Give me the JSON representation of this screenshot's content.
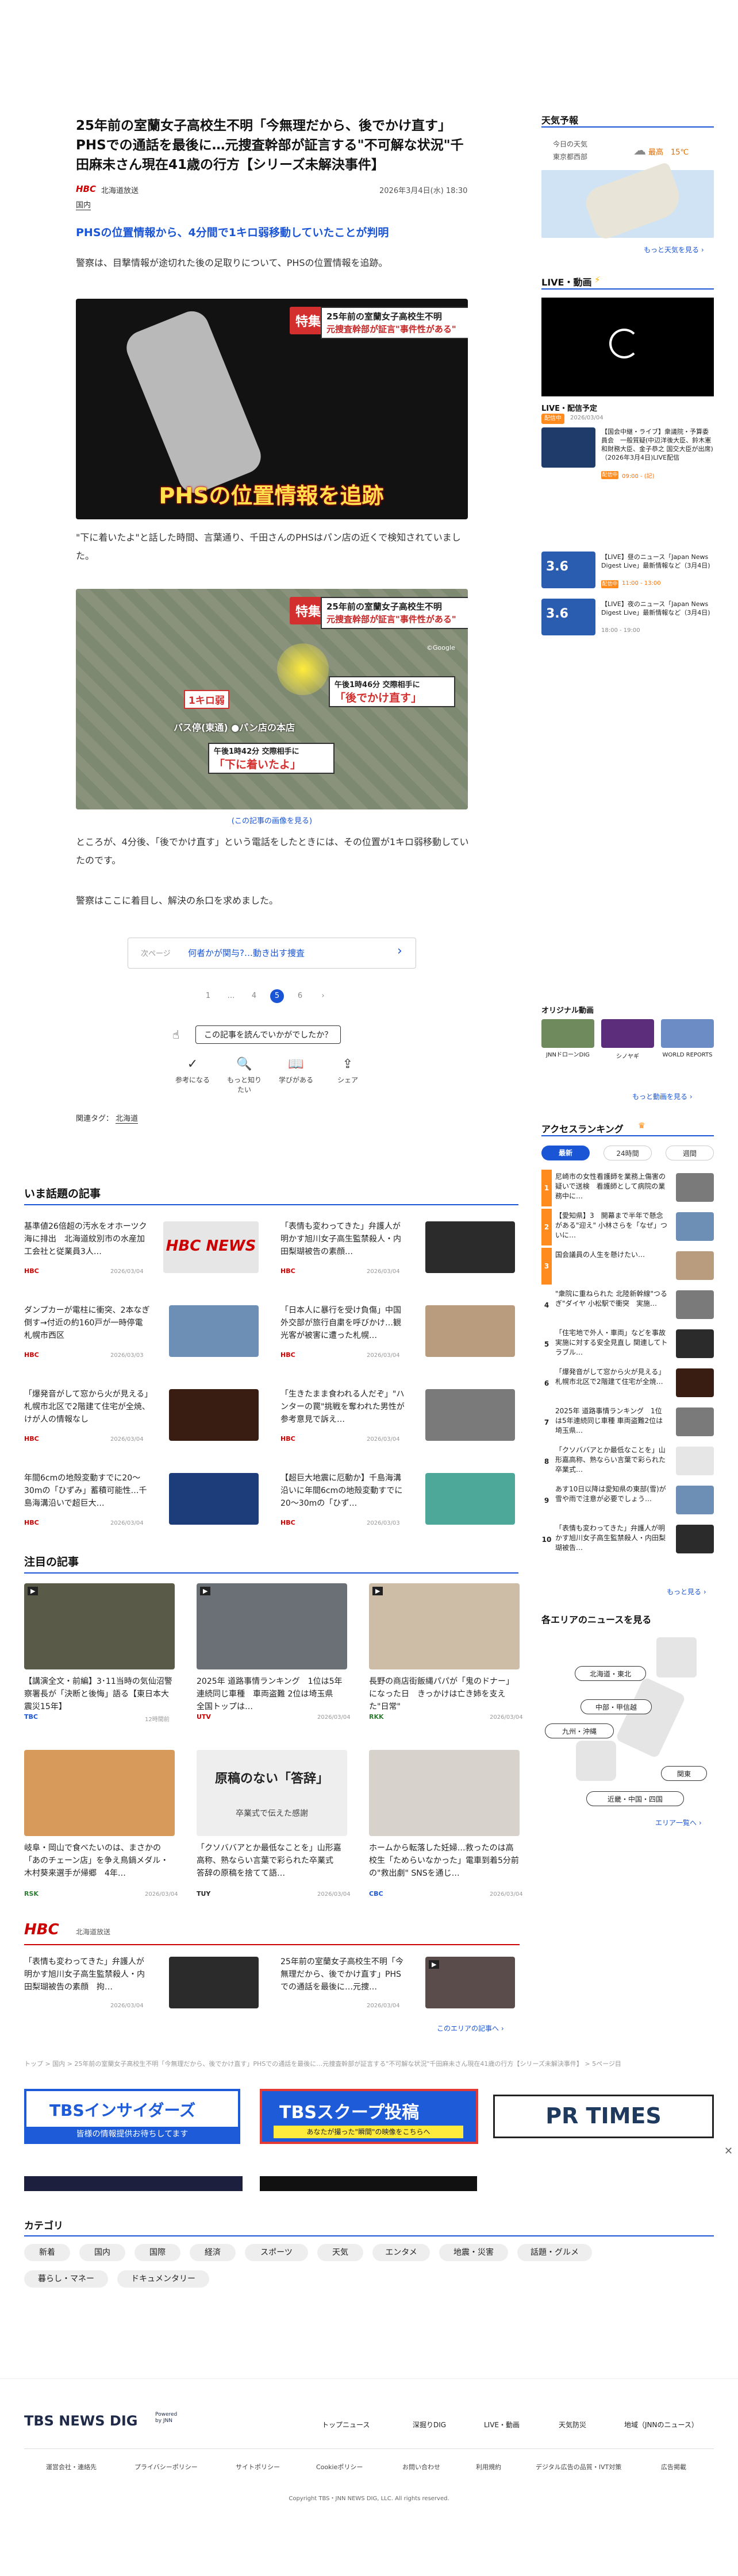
{
  "article": {
    "title": "25年前の室蘭女子高校生不明「今無理だから、後でかけ直す」PHSでの通話を最後に…元捜査幹部が証言する\"不可解な状況\"千田麻未さん現在41歳の行方【シリーズ未解決事件】",
    "logo": "HBC",
    "source": "北海道放送",
    "date": "2026年3月4日(水) 18:30",
    "category": "国内",
    "subhead": "PHSの位置情報から、4分間で1キロ弱移動していたことが判明",
    "p1": "警察は、目撃情報が途切れた後の足取りについて、PHSの位置情報を追跡。",
    "p2": "\"下に着いたよ\"と話した時間、言葉通り、千田さんのPHSはパン店の近くで検知されていました。",
    "caption2": "(この記事の画像を見る)",
    "p3": "ところが、4分後、「後でかけ直す」という電話をしたときには、その位置が1キロ弱移動していたのです。",
    "p4": "警察はここに着目し、解決の糸口を求めました。",
    "img1": {
      "tag": "特集",
      "line1": "25年前の室蘭女子高校生不明",
      "line2": "元捜査幹部が証言\"事件性がある\"",
      "bottom": "PHSの位置情報を追跡"
    },
    "img2": {
      "tag": "特集",
      "line1": "25年前の室蘭女子高校生不明",
      "line2": "元捜査幹部が証言\"事件性がある\"",
      "label_1km": "1キロ弱",
      "time_a": "午後1時46分 交際相手に",
      "quote_a": "「後でかけ直す」",
      "place": "バス停(東通)  ●パン店の本店",
      "time_b": "午後1時42分 交際相手に",
      "quote_b": "「下に着いたよ」",
      "credit": "©Google"
    },
    "next_page": {
      "label": "次ページ",
      "text": "何者かが関与?…動き出す捜査",
      "arrow": "›"
    },
    "pages": [
      "1",
      "…",
      "4",
      "5",
      "6",
      "›"
    ],
    "feedback": "この記事を読んでいかがでしたか？",
    "reactions": [
      {
        "icon": "✓",
        "label": "参考になる"
      },
      {
        "icon": "🔍",
        "label": "もっと知りたい"
      },
      {
        "icon": "📖",
        "label": "学びがある"
      },
      {
        "icon": "⇪",
        "label": "シェア"
      }
    ],
    "related_label": "関連タグ：",
    "related_tag": "北海道"
  },
  "trending": {
    "heading": "いま話題の記事",
    "items": [
      {
        "title": "基準値26倍超の汚水をオホーツク海に排出　北海道紋別市の水産加工会社と従業員3人…",
        "src": "HBC",
        "date": "2026/03/04",
        "thumb": "HBC NEWS"
      },
      {
        "title": "「表情も変わってきた」弁護人が明かす旭川女子高生監禁殺人・内田梨瑚被告の素顔…",
        "src": "HBC",
        "date": "2026/03/04",
        "thumb": ""
      },
      {
        "title": "ダンプカーが電柱に衝突、2本なぎ倒す→付近の約160戸が一時停電　札幌市西区",
        "src": "HBC",
        "date": "2026/03/03",
        "thumb": ""
      },
      {
        "title": "「日本人に暴行を受け負傷」中国外交部が旅行自粛を呼びかけ…観光客が被害に遭った札幌…",
        "src": "HBC",
        "date": "2026/03/04",
        "thumb": ""
      },
      {
        "title": "「爆発音がして窓から火が見える」札幌市北区で2階建て住宅が全焼、けが人の情報なし",
        "src": "HBC",
        "date": "2026/03/04",
        "thumb": ""
      },
      {
        "title": "「生きたまま食われる人だぞ」\"ハンターの罠\"挑戦を奪われた男性が参考意見で訴え…",
        "src": "HBC",
        "date": "2026/03/04",
        "thumb": ""
      },
      {
        "title": "年間6cmの地殻変動すでに20〜30mの「ひずみ」蓄積可能性…千島海溝沿いで超巨大…",
        "src": "HBC",
        "date": "2026/03/04",
        "thumb": ""
      },
      {
        "title": "【超巨大地震に厄動か】千島海溝沿いに年間6cmの地殻変動すでに20〜30mの「ひず…",
        "src": "HBC",
        "date": "2026/03/03",
        "thumb": ""
      }
    ]
  },
  "featured": {
    "heading": "注目の記事",
    "items": [
      {
        "title": "【講演全文・前編】3･11当時の気仙沼警察署長が「決断と後悔」語る【東日本大震災15年】",
        "src": "TBC",
        "date": "12時間前"
      },
      {
        "title": "2025年 道路事情ランキング　1位は5年連続同じ車種　車両盗難 2位は埼玉県　全国トップは…",
        "src": "UTV",
        "date": "2026/03/04"
      },
      {
        "title": "長野の商店街飯縄パパが「鬼のドナー」になった日　きっかけは亡き姉を支えた\"日常\"",
        "src": "RKK",
        "date": "2026/03/04"
      },
      {
        "title": "岐阜・岡山で食べたいのは、まさかの「あのチェーン店」を争え鳥鍋メダル・木村葵来選手が帰郷　4年…",
        "src": "RSK",
        "date": "2026/03/04"
      },
      {
        "title": "「クソババアとか最低なことを」山形嘉高称、熟ならい言葉で彩られた卒業式　答辞の原稿を捨てて語…",
        "src": "TUY",
        "date": "2026/03/04"
      },
      {
        "title": "ホームから転落した妊婦…救ったのは高校生「ためらいなかった」電車到着5分前の\"救出劇\" SNSを通じ…",
        "src": "CBC",
        "date": "2026/03/04"
      }
    ],
    "thumb_text": {
      "special": "原稿のない「答辞」",
      "special_sub": "卒業式で伝えた感謝"
    }
  },
  "hbc_block": {
    "logo": "HBC",
    "station": "北海道放送",
    "items": [
      {
        "title": "「表情も変わってきた」弁護人が明かす旭川女子高生監禁殺人・内田梨瑚被告の素顔　拘…",
        "date": "2026/03/04"
      },
      {
        "title": "25年前の室蘭女子高校生不明「今無理だから、後でかけ直す」PHSでの通話を最後に…元捜…",
        "date": "2026/03/04"
      }
    ],
    "more": "このエリアの記事へ ›"
  },
  "breadcrumb": "トップ > 国内 > 25年前の室蘭女子高校生不明「今無理だから、後でかけ直す」PHSでの通話を最後に…元捜査幹部が証言する\"不可解な状況\"千田麻未さん現在41歳の行方【シリーズ未解決事件】 > 5ページ目",
  "banners": [
    {
      "title": "TBSインサイダーズ",
      "sub": "皆様の情報提供お待ちしてます"
    },
    {
      "title": "TBSスクープ投稿",
      "sub": "あなたが撮った\"瞬間\"の映像をこちらへ"
    },
    {
      "title": "PR TIMES",
      "sub": ""
    }
  ],
  "categories": {
    "heading": "カテゴリ",
    "items": [
      "新着",
      "国内",
      "国際",
      "経済",
      "スポーツ",
      "天気",
      "エンタメ",
      "地震・災害",
      "話題・グルメ",
      "暮らし・マネー",
      "ドキュメンタリー"
    ]
  },
  "footer": {
    "logo": "TBS NEWS DIG",
    "powered": "Powered by JNN",
    "nav": [
      "トップニュース",
      "深掘りDIG",
      "LIVE・動画",
      "天気防災",
      "地域（JNNのニュース）"
    ],
    "links": [
      "運営会社・連絡先",
      "プライバシーポリシー",
      "サイトポリシー",
      "Cookieポリシー",
      "お問い合わせ",
      "利用規約",
      "デジタル広告の品質・IVT対策",
      "広告掲載"
    ],
    "copyright": "Copyright TBS・JNN NEWS DIG, LLC. All rights reserved."
  },
  "sidebar": {
    "weather": {
      "heading": "天気予報",
      "label": "今日の天気",
      "region": "東京都西部",
      "temp_high": "最高　15℃",
      "more": "もっと天気を見る ›"
    },
    "live": {
      "heading": "LIVE・動画",
      "schedule_heading": "LIVE・配信予定",
      "now_badge": "配信中",
      "now_date": "2026/03/04",
      "programs": [
        {
          "title": "【国会中継・ライブ】衆議院・予算委員会　一般質疑(中辺洋後大臣、鈴木憲和財務大臣、金子恭之 国交大臣が出席)（2026年3月4日)LIVE配信",
          "badge": "配信中",
          "time": "09:00 - (記)"
        },
        {
          "title": "【LIVE】昼のニュース「Japan News Digest Live」最新情報など（3月4日)",
          "badge": "配信中",
          "time": "11:00 - 13:00"
        },
        {
          "title": "【LIVE】夜のニュース「Japan News Digest Live」最新情報など（3月4日)",
          "badge": "",
          "time": "18:00 - 19:00"
        }
      ],
      "more": "もっと見る ›"
    },
    "original": {
      "heading": "オリジナル動画",
      "items": [
        "JNNドローンDIG",
        "シノヤギ",
        "WORLD REPORTS"
      ],
      "more": "もっと動画を見る ›"
    },
    "ranking": {
      "heading": "アクセスランキング",
      "tabs": [
        "最新",
        "24時間",
        "週間"
      ],
      "items": [
        "尼崎市の女性看護師を業務上傷害の疑いで送検　看護師として病院の業務中に…",
        "【愛知県】3　開幕まで半年で懸念がある\"迎え\" 小林さらを「なぜ」ついに…",
        "国会議員の人生を懸けたい…",
        "\"衆院に重ねられた 北陸新幹線\"つるぎ\"ダイヤ 小松駅で衝突　実施…",
        "「住宅地で外人・車両」などを事故実施に対する安全見直し 関連してトラブル…",
        "「爆発音がして窓から火が見える」札幌市北区で2階建て住宅が全焼…",
        "2025年 道路事情ランキング　1位は5年連続同じ車種 車両盗難2位は埼玉県…",
        "「クソババアとか最低なことを」山形嘉高称、熟ならい言葉で彩られた卒業式…",
        "あす10日以降は愛知県の東部(雪)が　雪や雨で注意が必要でしょう…",
        "「表情も変わってきた」弁護人が明かす旭川女子高生監禁殺人・内田梨瑚被告…"
      ],
      "more": "もっと見る ›"
    },
    "area": {
      "heading": "各エリアのニュースを見る",
      "regions": [
        "北海道・東北",
        "中部・甲信越",
        "九州・沖縄",
        "関東",
        "近畿・中国・四国"
      ],
      "more": "エリア一覧へ ›"
    }
  },
  "colors": {
    "accent": "#1a55d6",
    "hbc_red": "#c00000",
    "rank_orange": "#ff8a1e"
  }
}
